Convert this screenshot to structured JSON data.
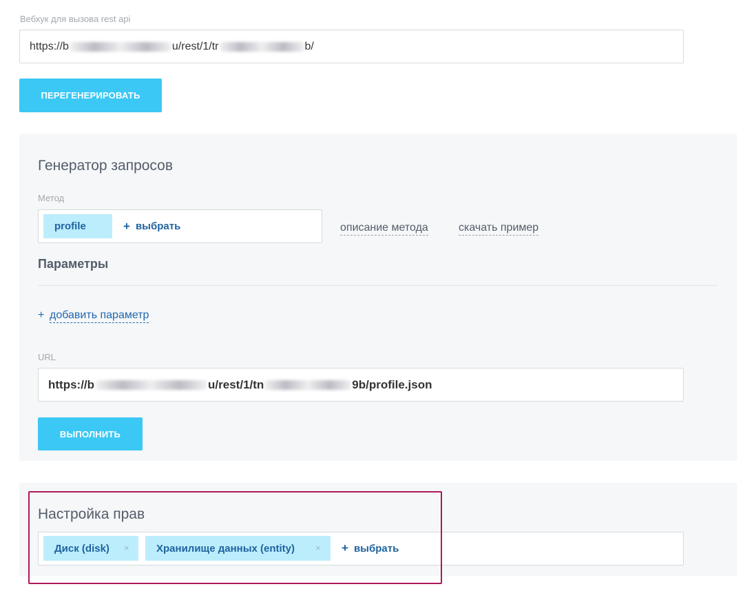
{
  "webhook": {
    "label": "Вебхук для вызова rest api",
    "url_prefix": "https://b",
    "url_mid": "u/rest/1/tr",
    "url_suffix": "b/"
  },
  "regenerate_label": "ПЕРЕГЕНЕРИРОВАТЬ",
  "generator": {
    "title": "Генератор запросов",
    "method_label": "Метод",
    "method_tag": "profile",
    "method_pick": "выбрать",
    "method_description_link": "описание метода",
    "download_example_link": "скачать пример",
    "params_title": "Параметры",
    "add_param_plus": "+",
    "add_param_link": "добавить параметр",
    "url_label": "URL",
    "url_prefix": "https://b",
    "url_mid": "u/rest/1/tn",
    "url_suffix": "9b/profile.json",
    "execute_label": "ВЫПОЛНИТЬ"
  },
  "rights": {
    "title": "Настройка прав",
    "tags": [
      "Диск (disk)",
      "Хранилище данных (entity)"
    ],
    "tag_remove": "×",
    "pick": "выбрать"
  },
  "colors": {
    "accent": "#3bc8f5",
    "tag_bg": "#bcedfc",
    "link": "#1f63a0",
    "highlight": "#b0175c",
    "panel_bg": "#f5f7f8"
  }
}
